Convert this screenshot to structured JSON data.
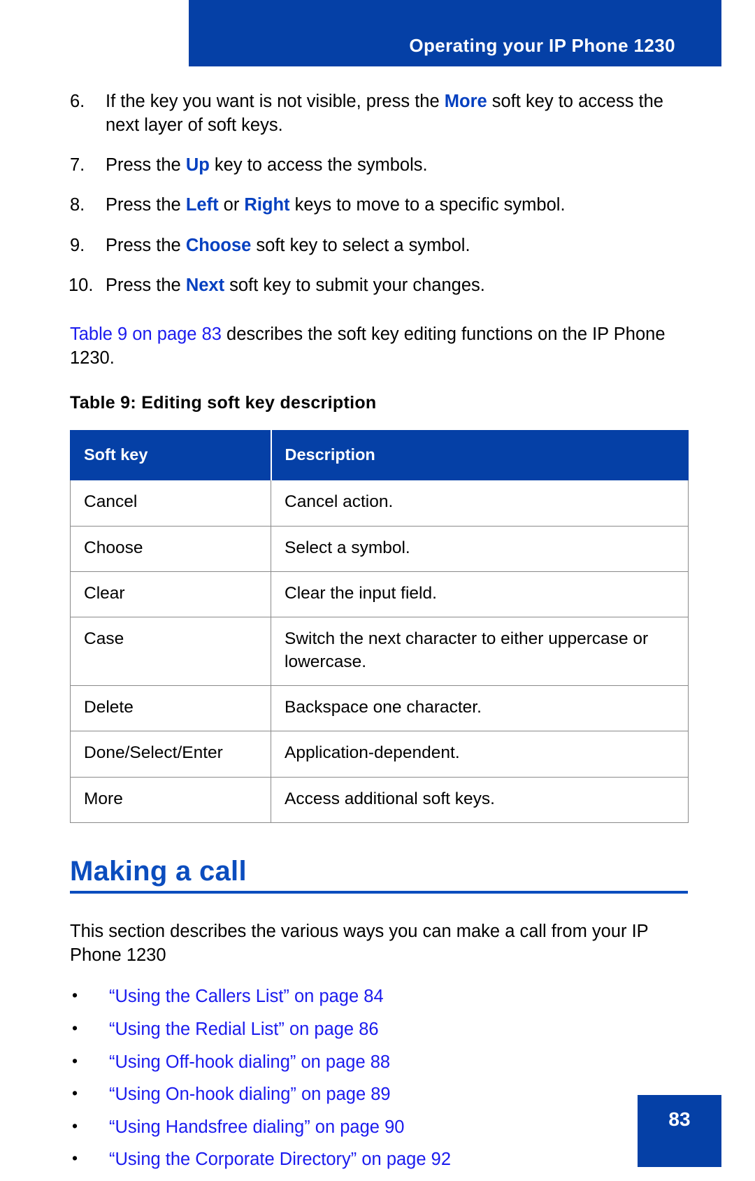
{
  "header": {
    "title": "Operating your IP Phone 1230"
  },
  "steps": [
    {
      "number": "6.",
      "parts": [
        {
          "text": "If the key you want is not visible, press the ",
          "style": "normal"
        },
        {
          "text": "More",
          "style": "keyword"
        },
        {
          "text": " soft key to access the next layer of soft keys.",
          "style": "normal"
        }
      ]
    },
    {
      "number": "7.",
      "parts": [
        {
          "text": "Press the ",
          "style": "normal"
        },
        {
          "text": "Up",
          "style": "keyword"
        },
        {
          "text": " key to access the symbols.",
          "style": "normal"
        }
      ]
    },
    {
      "number": "8.",
      "parts": [
        {
          "text": "Press the ",
          "style": "normal"
        },
        {
          "text": "Left",
          "style": "keyword"
        },
        {
          "text": " or ",
          "style": "normal"
        },
        {
          "text": "Right",
          "style": "keyword"
        },
        {
          "text": " keys to move to a specific symbol.",
          "style": "normal"
        }
      ]
    },
    {
      "number": "9.",
      "parts": [
        {
          "text": "Press the ",
          "style": "normal"
        },
        {
          "text": "Choose",
          "style": "keyword"
        },
        {
          "text": " soft key to select a symbol.",
          "style": "normal"
        }
      ]
    },
    {
      "number": "10.",
      "parts": [
        {
          "text": "Press the ",
          "style": "normal"
        },
        {
          "text": "Next",
          "style": "keyword"
        },
        {
          "text": " soft key to submit your changes.",
          "style": "normal"
        }
      ]
    }
  ],
  "xref_paragraph": {
    "link_text": "Table 9 on page 83",
    "rest_text": " describes the soft key editing functions on the IP Phone 1230."
  },
  "table": {
    "caption": "Table 9: Editing soft key description",
    "columns": [
      "Soft key",
      "Description"
    ],
    "rows": [
      {
        "key": "Cancel",
        "description": "Cancel action."
      },
      {
        "key": "Choose",
        "description": "Select a symbol."
      },
      {
        "key": "Clear",
        "description": "Clear the input field."
      },
      {
        "key": "Case",
        "description": "Switch the next character to either uppercase or lowercase."
      },
      {
        "key": "Delete",
        "description": "Backspace one character."
      },
      {
        "key": "Done/Select/Enter",
        "description": "Application-dependent."
      },
      {
        "key": "More",
        "description": "Access additional soft keys."
      }
    ]
  },
  "section": {
    "heading": "Making a call",
    "intro": "This section describes the various ways you can make a call from your IP Phone 1230",
    "bullet_marker": "•",
    "links": [
      "“Using the Callers List” on page 84",
      "“Using the Redial List” on page 86",
      "“Using Off-hook dialing” on page 88",
      "“Using On-hook dialing” on page 89",
      "“Using Handsfree dialing” on page 90",
      "“Using the Corporate Directory” on page 92"
    ]
  },
  "footer": {
    "page_number": "83"
  },
  "colors": {
    "brand_blue": "#0540A6",
    "heading_blue": "#0B4DBE",
    "keyword_blue": "#0540C0",
    "link_blue": "#1B1BEE"
  }
}
